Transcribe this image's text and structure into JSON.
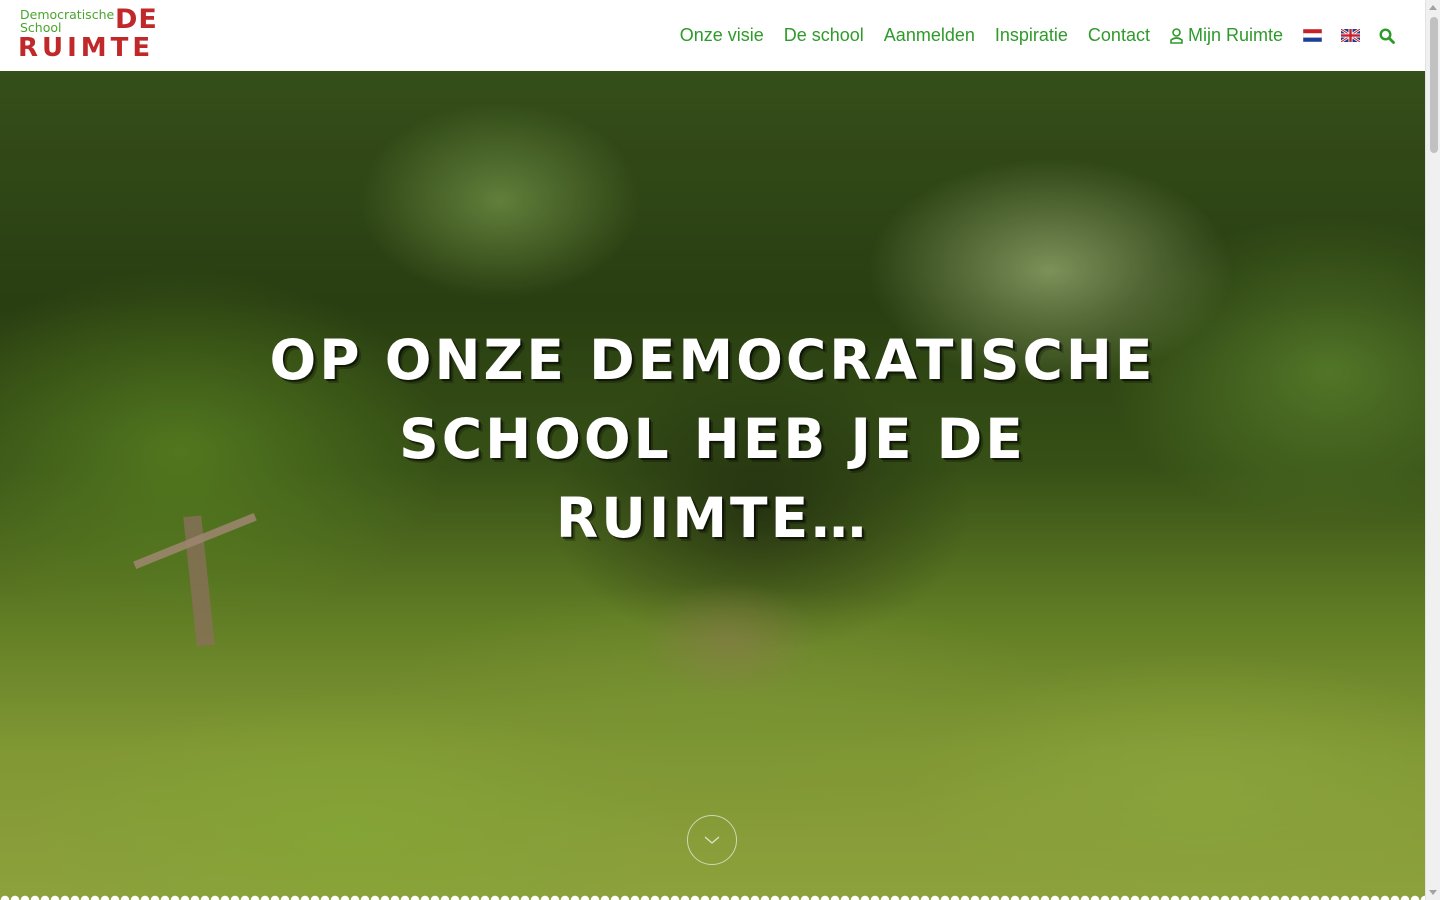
{
  "logo": {
    "small_line1": "Democratische",
    "small_line2": "School",
    "big_de": "DE",
    "big_ruimte": "RUIMTE"
  },
  "nav": {
    "items": [
      {
        "label": "Onze visie"
      },
      {
        "label": "De school"
      },
      {
        "label": "Aanmelden"
      },
      {
        "label": "Inspiratie"
      },
      {
        "label": "Contact"
      },
      {
        "label": "Mijn Ruimte"
      }
    ],
    "languages": [
      "nl-flag-icon",
      "en-flag-icon"
    ],
    "search_icon": "search-icon"
  },
  "hero": {
    "headline_line1": "Op onze democratische",
    "headline_line2": "school heb je de",
    "headline_line3": "ruimte…",
    "scroll_icon": "chevron-down-icon"
  },
  "colors": {
    "nav_green": "#2e9a2a",
    "logo_red": "#c0282a",
    "logo_green": "#4aa52e"
  }
}
